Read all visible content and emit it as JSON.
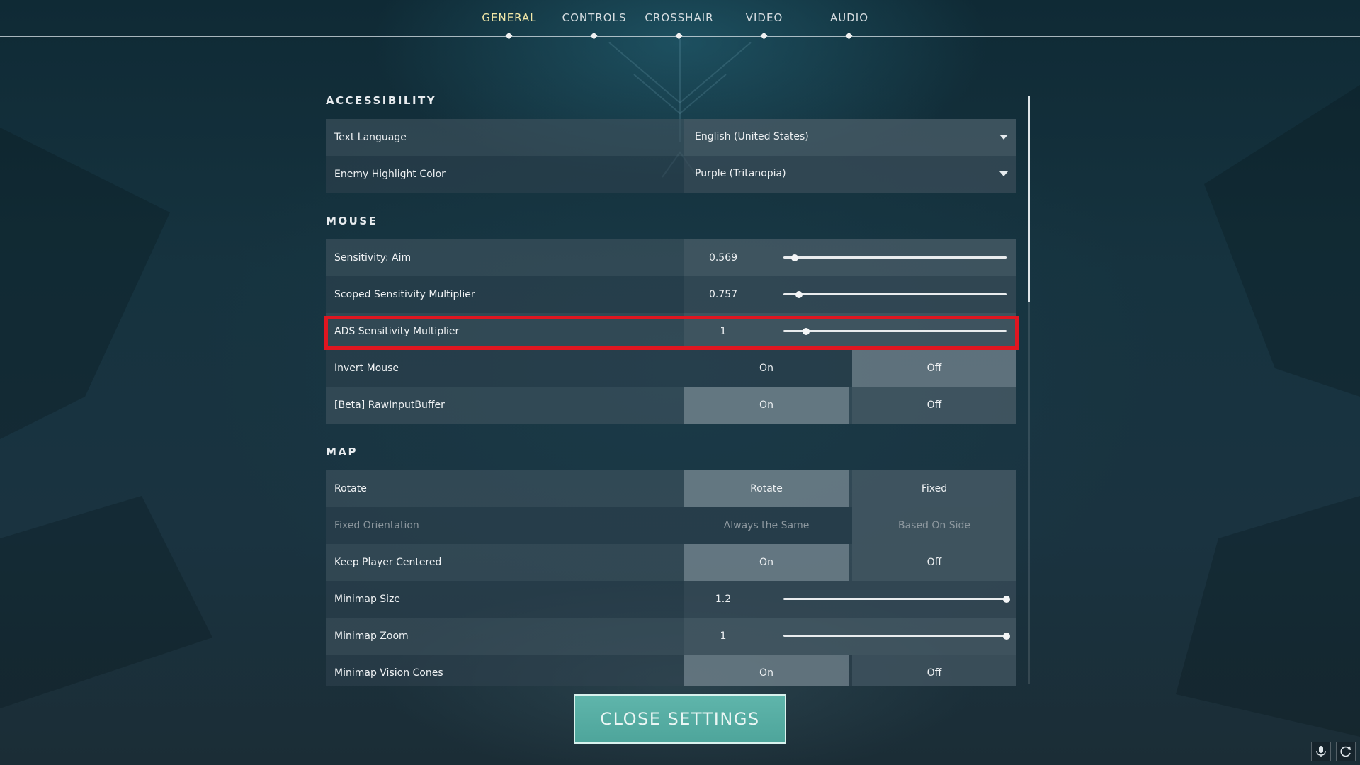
{
  "nav": {
    "tabs": [
      {
        "label": "GENERAL",
        "active": true
      },
      {
        "label": "CONTROLS",
        "active": false
      },
      {
        "label": "CROSSHAIR",
        "active": false
      },
      {
        "label": "VIDEO",
        "active": false
      },
      {
        "label": "AUDIO",
        "active": false
      }
    ]
  },
  "sections": {
    "accessibility": {
      "title": "ACCESSIBILITY",
      "text_language": {
        "label": "Text Language",
        "value": "English (United States)"
      },
      "enemy_highlight_color": {
        "label": "Enemy Highlight Color",
        "value": "Purple (Tritanopia)"
      }
    },
    "mouse": {
      "title": "MOUSE",
      "sensitivity_aim": {
        "label": "Sensitivity: Aim",
        "value": "0.569",
        "slider_fraction": 0.05
      },
      "scoped_sensitivity": {
        "label": "Scoped Sensitivity Multiplier",
        "value": "0.757",
        "slider_fraction": 0.07
      },
      "ads_sensitivity": {
        "label": "ADS Sensitivity Multiplier",
        "value": "1",
        "slider_fraction": 0.1,
        "highlighted": true
      },
      "invert_mouse": {
        "label": "Invert Mouse",
        "on_label": "On",
        "off_label": "Off",
        "selected": "Off"
      },
      "raw_input_buffer": {
        "label": "[Beta] RawInputBuffer",
        "on_label": "On",
        "off_label": "Off",
        "selected": "On"
      }
    },
    "map": {
      "title": "MAP",
      "rotate": {
        "label": "Rotate",
        "left_label": "Rotate",
        "right_label": "Fixed",
        "selected": "Rotate"
      },
      "fixed_orientation": {
        "label": "Fixed Orientation",
        "left_label": "Always the Same",
        "right_label": "Based On Side",
        "selected": "Based On Side",
        "disabled": true
      },
      "keep_player_centered": {
        "label": "Keep Player Centered",
        "on_label": "On",
        "off_label": "Off",
        "selected": "On"
      },
      "minimap_size": {
        "label": "Minimap Size",
        "value": "1.2",
        "slider_fraction": 1.0
      },
      "minimap_zoom": {
        "label": "Minimap Zoom",
        "value": "1",
        "slider_fraction": 1.0
      },
      "minimap_vision_cones": {
        "label": "Minimap Vision Cones",
        "on_label": "On",
        "off_label": "Off",
        "selected": "On"
      }
    }
  },
  "close_button": {
    "label": "CLOSE SETTINGS"
  },
  "colors": {
    "accent": "#4fa89e",
    "highlight": "#e01620",
    "active_tab": "#f2e8a8"
  },
  "corner_icons": [
    "microphone-icon",
    "refresh-icon"
  ]
}
